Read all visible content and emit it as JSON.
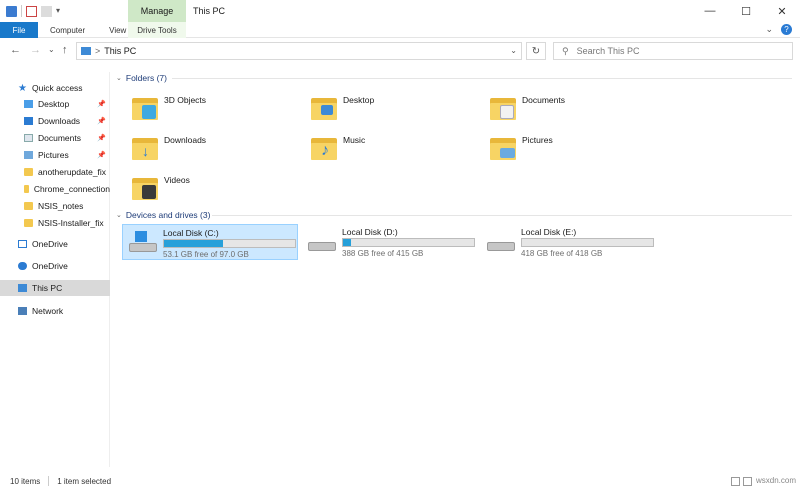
{
  "window": {
    "title": "This PC",
    "manage_tab": "Manage"
  },
  "ribbon": {
    "tabs": [
      "File",
      "Computer",
      "View",
      "Drive Tools"
    ],
    "help": "?"
  },
  "nav": {
    "back": "←",
    "forward": "→",
    "recent": "⌄",
    "up": "↑",
    "breadcrumb_sep": ">",
    "location": "This PC",
    "refresh": "↻",
    "search_placeholder": "Search This PC"
  },
  "sidebar": {
    "quick_access": "Quick access",
    "pinned": [
      {
        "label": "Desktop",
        "icon": "desktop-icon"
      },
      {
        "label": "Downloads",
        "icon": "downloads-icon"
      },
      {
        "label": "Documents",
        "icon": "documents-icon"
      },
      {
        "label": "Pictures",
        "icon": "pictures-icon"
      }
    ],
    "recent": [
      "anotherupdate_fix",
      "Chrome_connection",
      "NSIS_notes",
      "NSIS-Installer_fix"
    ],
    "onedrive_1": "OneDrive",
    "onedrive_2": "OneDrive",
    "this_pc": "This PC",
    "network": "Network"
  },
  "folders": {
    "header": "Folders (7)",
    "items": [
      "3D Objects",
      "Desktop",
      "Documents",
      "Downloads",
      "Music",
      "Pictures",
      "Videos"
    ]
  },
  "drives": {
    "header": "Devices and drives (3)",
    "items": [
      {
        "name": "Local Disk (C:)",
        "free": "53.1 GB free of 97.0 GB",
        "used_fraction": 0.45
      },
      {
        "name": "Local Disk (D:)",
        "free": "388 GB free of 415 GB",
        "used_fraction": 0.06
      },
      {
        "name": "Local Disk (E:)",
        "free": "418 GB free of 418 GB",
        "used_fraction": 0.0
      }
    ]
  },
  "status": {
    "items_count": "10 items",
    "selected": "1 item selected",
    "watermark": "wsxdn.com"
  },
  "colors": {
    "accent": "#1979ca",
    "drive_fill": "#26a0da",
    "selection": "#cce8ff",
    "manage": "#cfe8c7"
  }
}
